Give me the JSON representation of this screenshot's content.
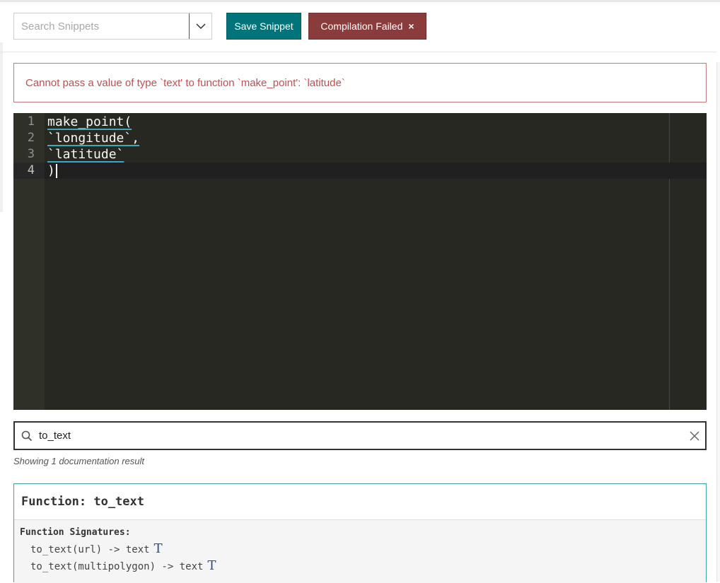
{
  "toolbar": {
    "search_placeholder": "Search Snippets",
    "save_label": "Save Snippet",
    "status_label": "Compilation Failed",
    "status_icon": "×"
  },
  "error": {
    "message": "Cannot pass a value of type `text' to function `make_point': `latitude`"
  },
  "editor": {
    "lines": [
      {
        "num": "1",
        "text": "make_point("
      },
      {
        "num": "2",
        "text": "`longitude`,"
      },
      {
        "num": "3",
        "text": "`latitude`"
      },
      {
        "num": "4",
        "text": ")"
      }
    ]
  },
  "docs": {
    "search_value": "to_text",
    "result_count": "Showing 1 documentation result",
    "card_title": "Function: to_text",
    "signatures_label": "Function Signatures:",
    "signatures": [
      {
        "text": "to_text(url) -> text",
        "type_glyph": "T"
      },
      {
        "text": "to_text(multipolygon) -> text",
        "type_glyph": "T"
      }
    ]
  },
  "colors": {
    "save_button": "#00737b",
    "fail_button": "#8a3b3b",
    "error_text": "#c0504d",
    "editor_bg": "#272822"
  }
}
